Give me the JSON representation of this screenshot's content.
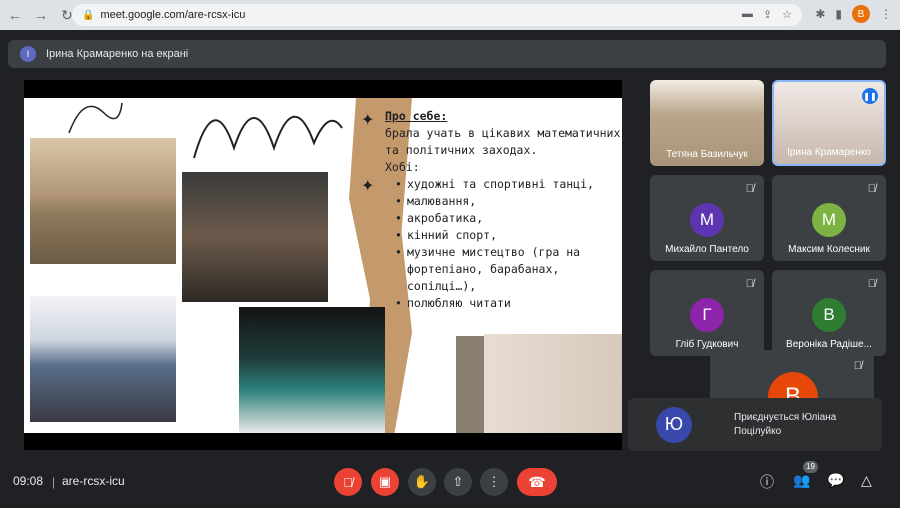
{
  "browser": {
    "url": "meet.google.com/are-rcsx-icu",
    "profile_initial": "В"
  },
  "banner": {
    "text": "Ірина Крамаренко на екрані",
    "avatar_initial": "І"
  },
  "slide": {
    "heading": "Про себе:",
    "intro": "брала учать в цікавих математичних та політичних заходах.",
    "hobby_label": "Хобі:",
    "hobbies": [
      "художні та спортивні танці,",
      "малювання,",
      "акробатика,",
      "кінний спорт,",
      "музичне мистецтво (гра на фортепіано, барабанах, сопілці…),",
      "полюбляю читати"
    ]
  },
  "participants": [
    {
      "name": "Тетяна Базильчук",
      "type": "video"
    },
    {
      "name": "Ірина Крамаренко",
      "type": "video",
      "speaking": true
    },
    {
      "name": "Михайло Пантело",
      "initial": "М",
      "color": "#5e35b1",
      "muted": true
    },
    {
      "name": "Максим Колесник",
      "initial": "М",
      "color": "#7cb342",
      "muted": true
    },
    {
      "name": "Гліб Гудкович",
      "initial": "Г",
      "color": "#8e24aa",
      "muted": true
    },
    {
      "name": "Вероніка Радіше...",
      "initial": "В",
      "color": "#2e7d32",
      "muted": true
    }
  ],
  "floating_tile": {
    "initial": "В",
    "color": "#e8470a"
  },
  "join_notice": {
    "initial": "Ю",
    "text": "Приєднується Юліана Поцілуйко"
  },
  "bottom": {
    "time": "09:08",
    "separator": "|",
    "meeting_code": "are-rcsx-icu",
    "participant_count": "19"
  }
}
